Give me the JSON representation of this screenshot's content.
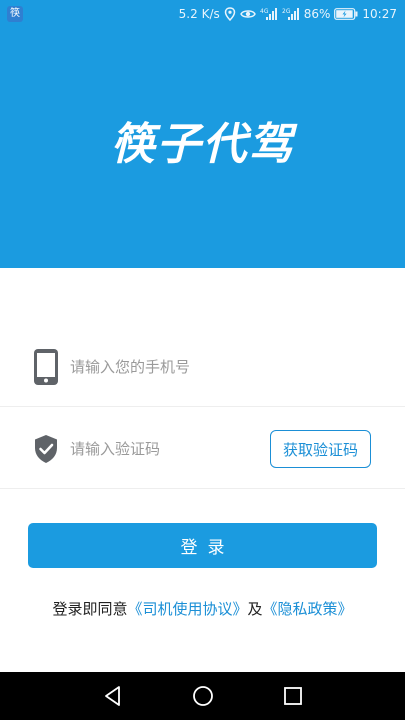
{
  "status_bar": {
    "app_icon_text": "筷",
    "network_speed": "5.2 K/s",
    "network_1": "4G",
    "network_2": "2G",
    "battery": "86%",
    "time": "10:27"
  },
  "header": {
    "app_title": "筷子代驾"
  },
  "login_form": {
    "phone_placeholder": "请输入您的手机号",
    "code_placeholder": "请输入验证码",
    "get_code_label": "获取验证码",
    "login_label": "登录"
  },
  "agreement": {
    "prefix": "登录即同意",
    "driver_agreement": "《司机使用协议》",
    "conjunction": "及",
    "privacy_policy": "《隐私政策》"
  },
  "colors": {
    "primary": "#1b9be0",
    "link": "#1b8fd6",
    "nav_bar": "#000000"
  },
  "icons": {
    "phone_row": "smartphone-icon",
    "code_row": "shield-check-icon",
    "nav": [
      "back-triangle-icon",
      "home-circle-icon",
      "recent-square-icon"
    ]
  }
}
